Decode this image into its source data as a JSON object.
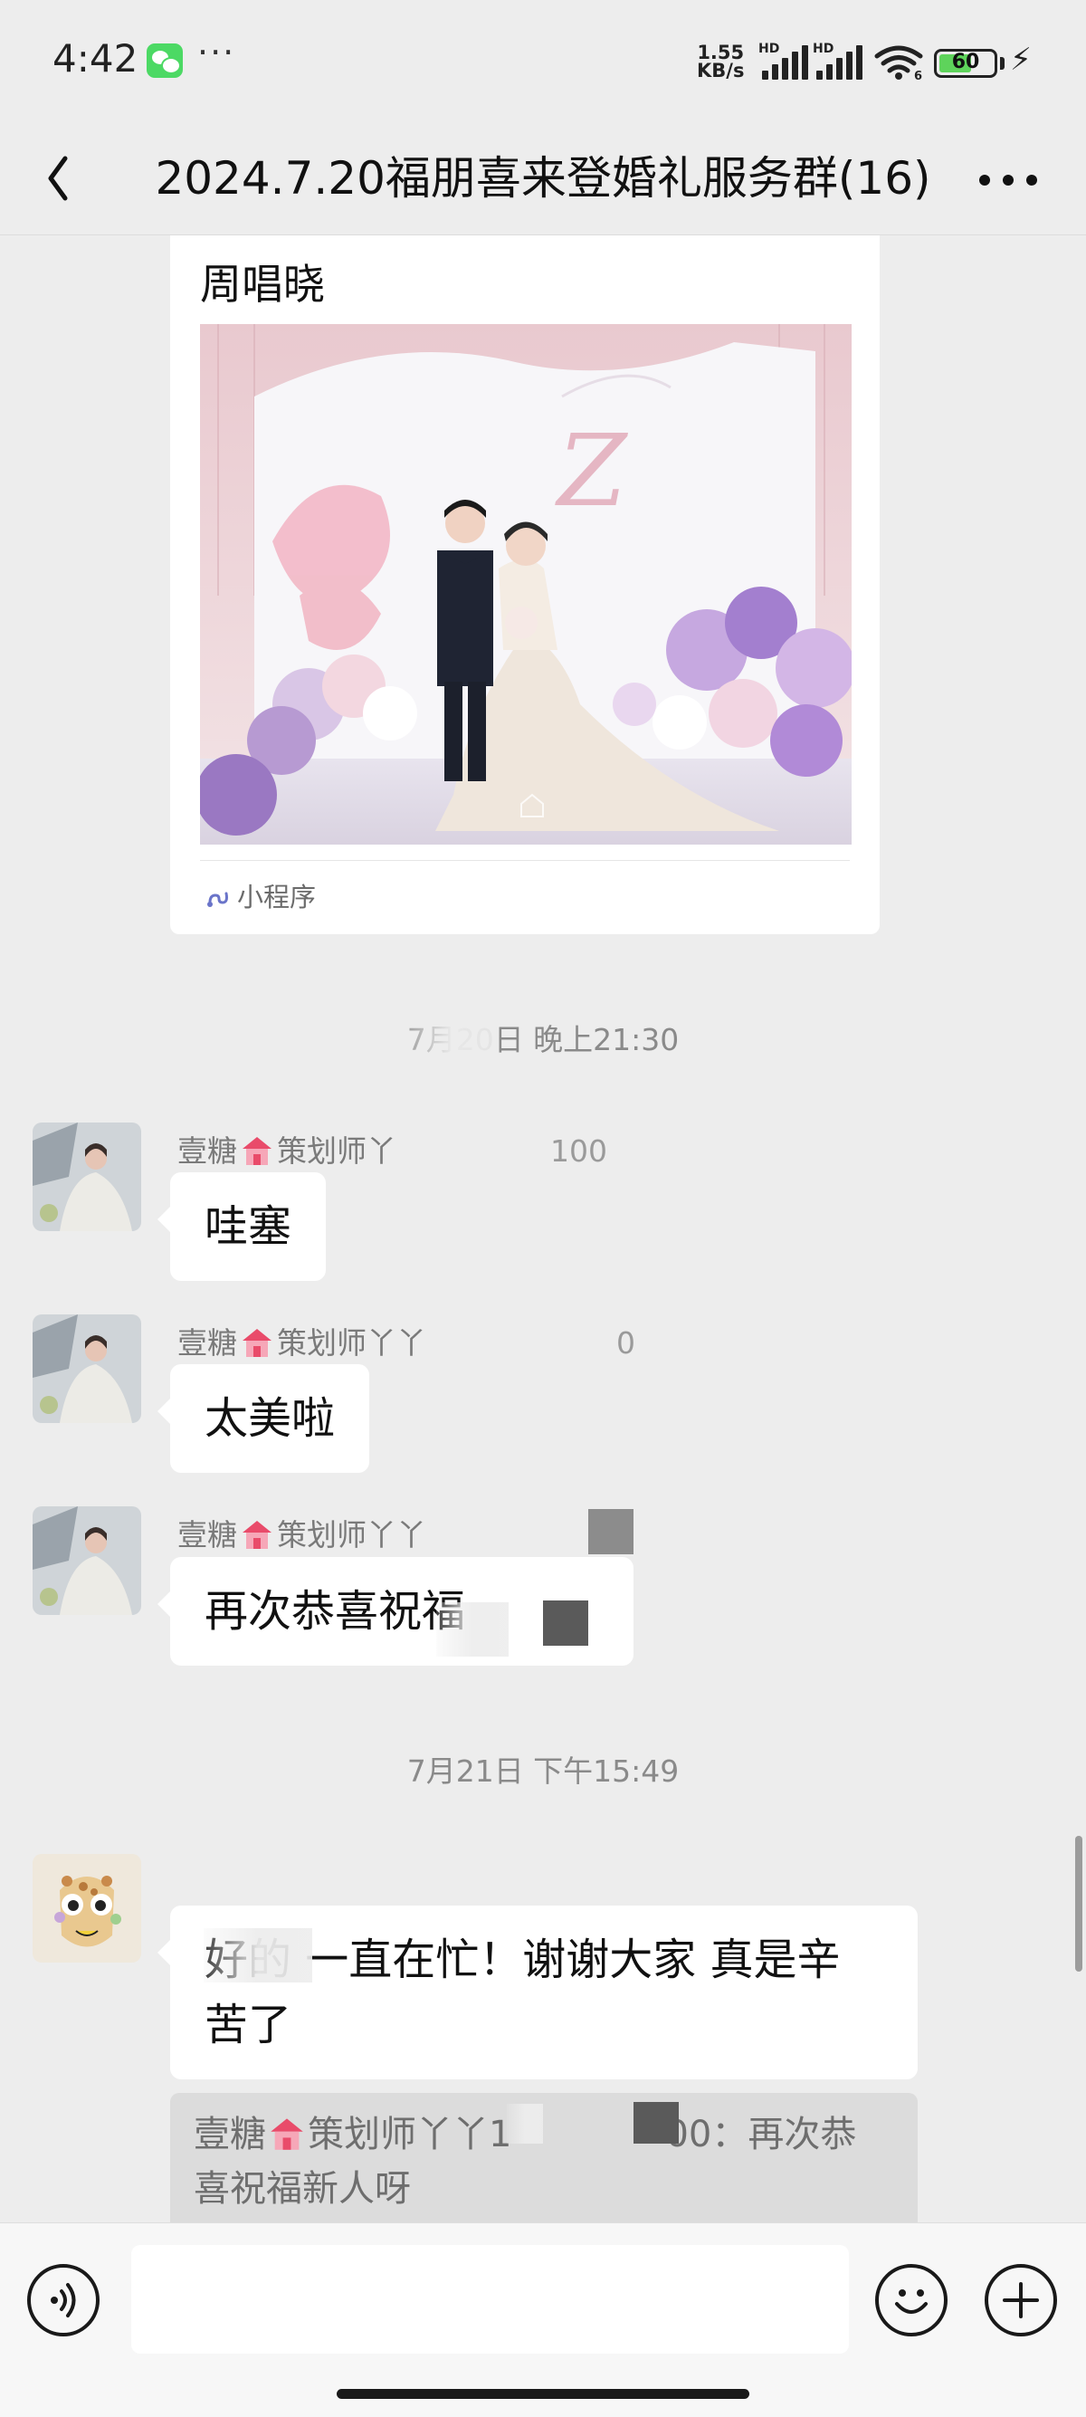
{
  "status_bar": {
    "time": "4:42",
    "more": "···",
    "net_speed_value": "1.55",
    "net_speed_unit": "KB/s",
    "hd_label": "HD",
    "wifi_band": "6",
    "battery_level": "60",
    "battery_fraction": 0.6
  },
  "nav": {
    "title": "2024.7.20福朋喜来登婚礼服务群(16)"
  },
  "card": {
    "title": "周唱晓",
    "footer_label": "小程序"
  },
  "timestamps": [
    "7月20日 晚上21:30",
    "7月21日 下午15:49"
  ],
  "messages": [
    {
      "sender_prefix": "壹糖",
      "sender_suffix": "策划师丫",
      "sender_tail": "100",
      "text": "哇塞"
    },
    {
      "sender_prefix": "壹糖",
      "sender_suffix": "策划师丫丫",
      "sender_tail": "0",
      "text": "太美啦"
    },
    {
      "sender_prefix": "壹糖",
      "sender_suffix": "策划师丫丫",
      "sender_tail": "",
      "text": "再次恭喜祝福"
    },
    {
      "text_line1": "好的 一直在忙！谢谢大家  真是辛",
      "text_line2": "苦了"
    }
  ],
  "quote": {
    "prefix": "壹糖",
    "middle": "策划师丫丫1",
    "tail": "00：再次恭",
    "line2": "喜祝福新人呀"
  },
  "colors": {
    "background": "#ededed",
    "bubble": "#ffffff",
    "quote_bg": "#dcdcdc",
    "battery_fill": "#5ed35b",
    "wechat_green": "#4cd964"
  }
}
